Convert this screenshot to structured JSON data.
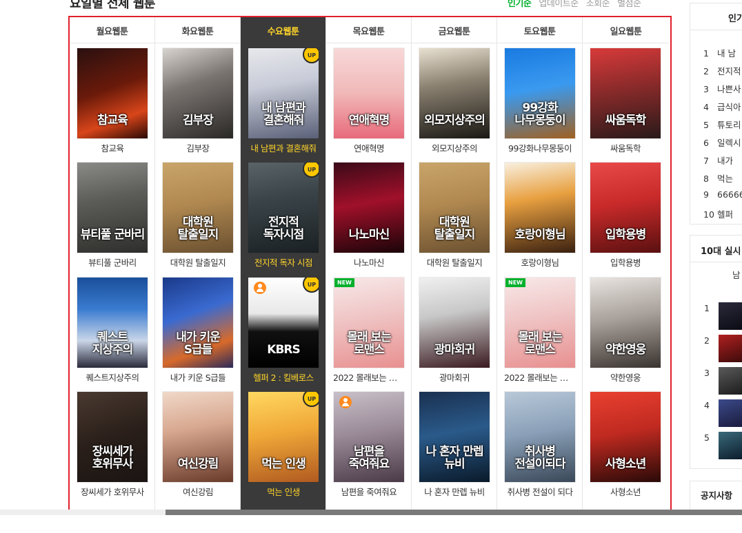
{
  "header": {
    "title": "요일별 전체 웹툰",
    "sort_tabs": [
      {
        "label": "인기순",
        "active": true
      },
      {
        "label": "업데이트순",
        "active": false
      },
      {
        "label": "조회순",
        "active": false
      },
      {
        "label": "별점순",
        "active": false
      }
    ]
  },
  "colors": {
    "accent_green": "#00b02c",
    "highlight_border": "#e0202c",
    "active_column_bg": "#3a3a3a",
    "active_title": "#ffd42a",
    "up_badge": "#ffc700"
  },
  "days": [
    {
      "label": "월요웹툰",
      "active": false,
      "comics": [
        {
          "title": "참교육",
          "cover_text": "참교육",
          "bg": "linear-gradient(160deg,#2a1010 0%,#6a1a0a 45%,#d8451a 75%,#2a0a05 100%)",
          "badge": ""
        },
        {
          "title": "뷰티풀 군바리",
          "cover_text": "뷰티풀 군바리",
          "bg": "linear-gradient(170deg,#8a8a86 0%,#5c5c58 40%,#2e2e2c 100%)",
          "badge": ""
        },
        {
          "title": "퀘스트지상주의",
          "cover_text": "퀘스트\n지상주의",
          "bg": "linear-gradient(180deg,#1a4f9a 0%,#3a7bd0 35%,#c9d6e8 70%,#2a2a3a 100%)",
          "badge": ""
        },
        {
          "title": "장씨세가 호위무사",
          "cover_text": "장씨세가\n호위무사",
          "bg": "linear-gradient(160deg,#4a3a30 0%,#2a1f1a 50%,#1a1412 100%)",
          "badge": ""
        }
      ]
    },
    {
      "label": "화요웹툰",
      "active": false,
      "comics": [
        {
          "title": "김부장",
          "cover_text": "김부장",
          "bg": "linear-gradient(160deg,#d8d4d0 0%,#7a7470 40%,#2a2826 100%)",
          "badge": ""
        },
        {
          "title": "대학원 탈출일지",
          "cover_text": "대학원\n탈출일지",
          "bg": "linear-gradient(170deg,#c9a56a 0%,#b08850 45%,#6a5030 100%)",
          "badge": ""
        },
        {
          "title": "내가 키운 S급들",
          "cover_text": "내가 키운\nS급들",
          "bg": "linear-gradient(160deg,#1a3a8a 0%,#3a6ad0 40%,#d86a2a 75%,#2a2a5a 100%)",
          "badge": ""
        },
        {
          "title": "여신강림",
          "cover_text": "여신강림",
          "bg": "linear-gradient(170deg,#f0d8c8 0%,#d8a890 40%,#6a3a2a 100%)",
          "badge": ""
        }
      ]
    },
    {
      "label": "수요웹툰",
      "active": true,
      "comics": [
        {
          "title": "내 남편과 결혼해줘",
          "cover_text": "내 남편과\n결혼해줘",
          "bg": "linear-gradient(170deg,#e8e8ec 0%,#c8ccd8 40%,#5a6078 100%)",
          "badge": "UP"
        },
        {
          "title": "전지적 독자 시점",
          "cover_text": "전지적\n독자시점",
          "bg": "linear-gradient(170deg,#5a6468 0%,#3a4448 40%,#1a2024 100%)",
          "badge": "UP"
        },
        {
          "title": "헬퍼 2 : 킬베로스",
          "cover_text": "KBRS",
          "bg": "linear-gradient(180deg,#ffffff 0%,#e8e8e8 40%,#101010 60%,#000000 100%)",
          "badge": "UP",
          "person": true
        },
        {
          "title": "먹는 인생",
          "cover_text": "먹는 인생",
          "bg": "linear-gradient(170deg,#ffd860 0%,#f0a838 45%,#b05a20 100%)",
          "badge": "UP"
        }
      ]
    },
    {
      "label": "목요웹툰",
      "active": false,
      "comics": [
        {
          "title": "연애혁명",
          "cover_text": "연애혁명",
          "bg": "linear-gradient(180deg,#f8d8d8 0%,#f0b8b8 50%,#e86a7a 100%)",
          "badge": ""
        },
        {
          "title": "나노마신",
          "cover_text": "나노마신",
          "bg": "linear-gradient(170deg,#3a0a18 0%,#a0102a 45%,#1a0408 100%)",
          "badge": ""
        },
        {
          "title": "2022 몰래보는 로맨스",
          "cover_text": "몰래 보는\n로맨스",
          "bg": "linear-gradient(170deg,#f8e8e8 0%,#f0c8c8 40%,#e89090 100%)",
          "badge": "NEW"
        },
        {
          "title": "남편을 죽여줘요",
          "cover_text": "남편을\n죽여줘요",
          "bg": "linear-gradient(170deg,#c8c0c8 0%,#9a8a98 45%,#4a3a48 100%)",
          "badge": "",
          "person": true
        }
      ]
    },
    {
      "label": "금요웹툰",
      "active": false,
      "comics": [
        {
          "title": "외모지상주의",
          "cover_text": "외모지상주의",
          "bg": "linear-gradient(170deg,#e8e0d0 0%,#8a8070 40%,#1a1814 100%)",
          "badge": ""
        },
        {
          "title": "대학원 탈출일지",
          "cover_text": "대학원\n탈출일지",
          "bg": "linear-gradient(170deg,#c9a56a 0%,#b08850 45%,#6a5030 100%)",
          "badge": ""
        },
        {
          "title": "광마회귀",
          "cover_text": "광마회귀",
          "bg": "linear-gradient(170deg,#f0f0f0 0%,#c8c8c8 40%,#3a1a20 100%)",
          "badge": ""
        },
        {
          "title": "나 혼자 만렙 뉴비",
          "cover_text": "나 혼자 만렙\n뉴비",
          "bg": "linear-gradient(170deg,#1a3050 0%,#2a5a8a 45%,#0a1a2a 100%)",
          "badge": ""
        }
      ]
    },
    {
      "label": "토요웹툰",
      "active": false,
      "comics": [
        {
          "title": "99강화나무몽둥이",
          "cover_text": "99강화\n나무몽둥이",
          "bg": "linear-gradient(170deg,#1a7ae0 0%,#3a9af0 45%,#a06020 100%)",
          "badge": ""
        },
        {
          "title": "호랑이형님",
          "cover_text": "호랑이형님",
          "bg": "linear-gradient(170deg,#f8f0e0 0%,#e8a040 40%,#3a2010 100%)",
          "badge": ""
        },
        {
          "title": "2022 몰래보는 로맨스",
          "cover_text": "몰래 보는\n로맨스",
          "bg": "linear-gradient(170deg,#f8e8e8 0%,#f0c8c8 40%,#e89090 100%)",
          "badge": "NEW"
        },
        {
          "title": "취사병 전설이 되다",
          "cover_text": "취사병\n전설이되다",
          "bg": "linear-gradient(170deg,#b8c8d8 0%,#8aa0b8 45%,#3a4858 100%)",
          "badge": ""
        }
      ]
    },
    {
      "label": "일요웹툰",
      "active": false,
      "comics": [
        {
          "title": "싸움독학",
          "cover_text": "싸움독학",
          "bg": "linear-gradient(170deg,#d83a3a 0%,#8a2a2a 45%,#2a1a1a 100%)",
          "badge": ""
        },
        {
          "title": "입학용병",
          "cover_text": "입학용병",
          "bg": "linear-gradient(170deg,#e84a4a 0%,#c82a2a 45%,#5a1010 100%)",
          "badge": ""
        },
        {
          "title": "약한영웅",
          "cover_text": "약한영웅",
          "bg": "linear-gradient(170deg,#e8e4e0 0%,#a8a09a 45%,#3a3430 100%)",
          "badge": ""
        },
        {
          "title": "사형소년",
          "cover_text": "사형소년",
          "bg": "linear-gradient(170deg,#e84030 0%,#c02a20 45%,#2a0a08 100%)",
          "badge": ""
        }
      ]
    }
  ],
  "sidebar": {
    "popular_title": "인기",
    "popular_items": [
      {
        "rank": "1",
        "title": "내 남"
      },
      {
        "rank": "2",
        "title": "전지적"
      },
      {
        "rank": "3",
        "title": "나쁜사"
      },
      {
        "rank": "4",
        "title": "급식아"
      },
      {
        "rank": "5",
        "title": "튜토리"
      },
      {
        "rank": "6",
        "title": "일렉시"
      },
      {
        "rank": "7",
        "title": "내가"
      },
      {
        "rank": "8",
        "title": "먹는"
      },
      {
        "rank": "9",
        "title": "66666"
      },
      {
        "rank": "10",
        "title": "헬퍼"
      }
    ],
    "teen_title": "10대 실시",
    "teen_tab": "남",
    "teen_ranks": [
      "1",
      "2",
      "3",
      "4",
      "5"
    ],
    "notice_title": "공지사항"
  }
}
